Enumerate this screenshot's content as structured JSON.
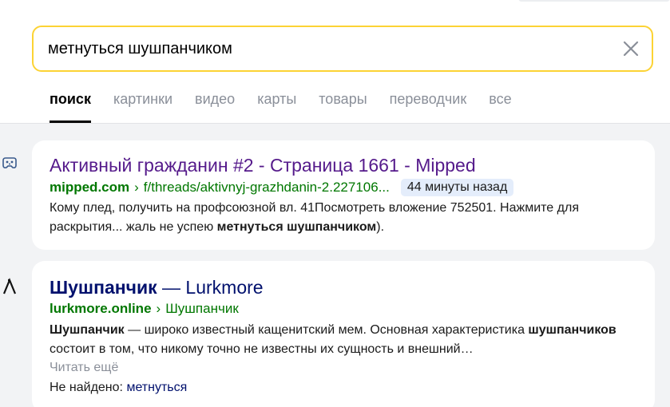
{
  "search": {
    "query": "метнуться шушпанчиком"
  },
  "tabs": [
    {
      "label": "поиск",
      "active": true
    },
    {
      "label": "картинки"
    },
    {
      "label": "видео"
    },
    {
      "label": "карты"
    },
    {
      "label": "товары"
    },
    {
      "label": "переводчик"
    },
    {
      "label": "все"
    }
  ],
  "results": [
    {
      "favicon": "gamepad-icon",
      "title": "Активный гражданин #2 - Страница 1661 - Mipped",
      "domain": "mipped.com",
      "path": "f/threads/aktivnyj-grazhdanin-2.227106...",
      "time_badge": "44 минуты назад",
      "snippet_before": "Кому плед, получить на профсоюзной вл. 41Посмотреть вложение 752501. Нажмите для раскрытия... жаль не успею ",
      "snippet_bold": "метнуться шушпанчиком",
      "snippet_after": ")."
    },
    {
      "favicon": "lambda-icon",
      "title_bold": "Шушпанчик",
      "title_rest": " — Lurkmore",
      "domain": "lurkmore.online",
      "path": "Шушпанчик",
      "snippet_b1": "Шушпанчик",
      "snippet_t1": " — широко известный кащенитский мем. Основная характеристика ",
      "snippet_b2": "шушпанчиков",
      "snippet_t2": " состоит в том, что никому точно не известны их сущность и внешний…",
      "read_more": "Читать ещё",
      "not_found_label": "Не найдено:",
      "not_found_word": "метнуться"
    }
  ],
  "colors": {
    "accent_border": "#fcd334",
    "visited_link": "#551a8b",
    "link": "#00106d",
    "url_green": "#007700",
    "time_badge_bg": "#e4edfb"
  }
}
